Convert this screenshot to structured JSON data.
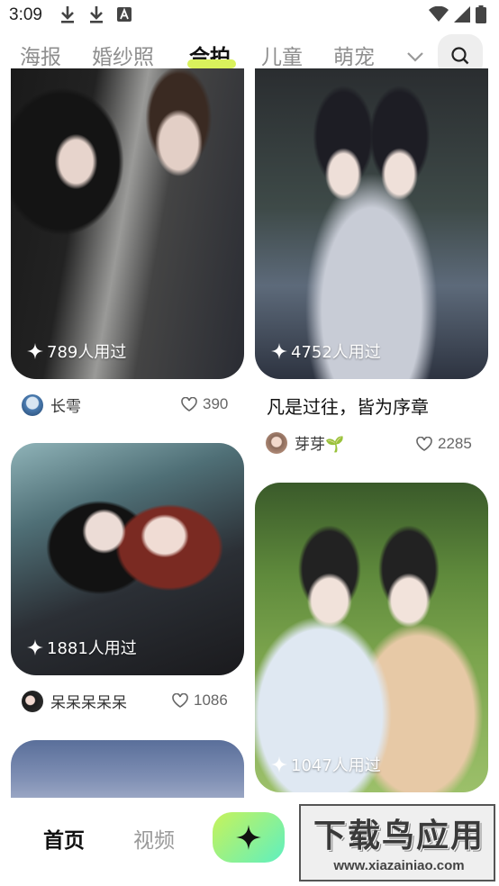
{
  "status_bar": {
    "time": "3:09",
    "left_icons": [
      "download-icon",
      "download-icon",
      "font-icon"
    ],
    "right_icons": [
      "wifi-icon",
      "signal-icon",
      "battery-icon"
    ]
  },
  "tabs": {
    "items": [
      {
        "label": "海报"
      },
      {
        "label": "婚纱照"
      },
      {
        "label": "合拍"
      },
      {
        "label": "儿童"
      },
      {
        "label": "萌宠"
      }
    ],
    "active_index": 2,
    "accent": "#d9f25c"
  },
  "feed": {
    "left": [
      {
        "used": "789人用过",
        "author": "长雩",
        "likes": "390"
      },
      {
        "used": "1881人用过",
        "author": "呆呆呆呆呆",
        "likes": "1086"
      }
    ],
    "right": [
      {
        "used": "4752人用过",
        "title": "凡是过往，皆为序章",
        "author": "芽芽🌱",
        "likes": "2285"
      },
      {
        "used": "1047人用过"
      }
    ]
  },
  "bottom_nav": {
    "home": "首页",
    "video": "视频",
    "create_icon": "sparkle-icon",
    "create_gradient": [
      "#c7f25a",
      "#5ef0c0"
    ]
  },
  "watermark": {
    "main": "下载鸟应用",
    "url": "www.xiazainiao.com"
  }
}
